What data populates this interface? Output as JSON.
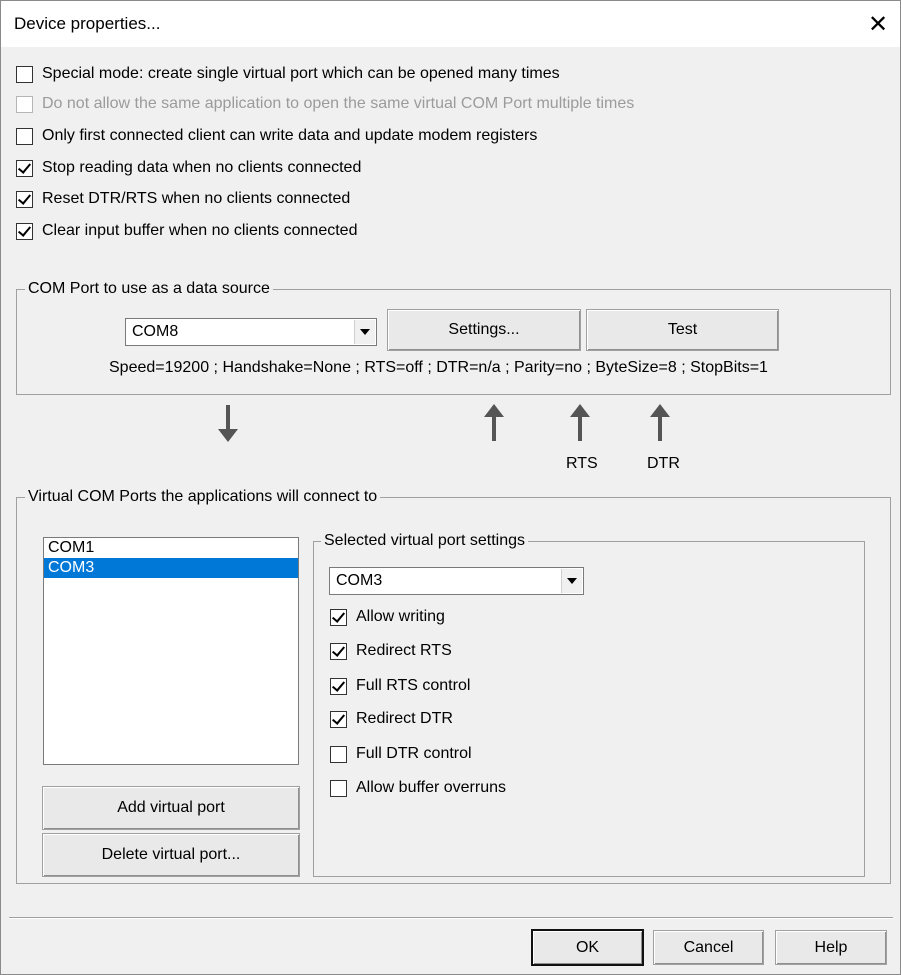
{
  "window": {
    "title": "Device properties..."
  },
  "options": [
    {
      "label": "Special mode: create single virtual port which can be opened many times",
      "checked": false,
      "disabled": false
    },
    {
      "label": "Do not allow the same application to open the same virtual COM Port multiple times",
      "checked": false,
      "disabled": true
    },
    {
      "label": "Only first connected client can write data and update modem registers",
      "checked": false,
      "disabled": false
    },
    {
      "label": "Stop reading data when no clients connected",
      "checked": true,
      "disabled": false
    },
    {
      "label": "Reset DTR/RTS when no clients connected",
      "checked": true,
      "disabled": false
    },
    {
      "label": "Clear input buffer when no clients connected",
      "checked": true,
      "disabled": false
    }
  ],
  "source_group": {
    "label": "COM Port to use as a data source",
    "selected_port": "COM8",
    "settings_button": "Settings...",
    "test_button": "Test",
    "info": "Speed=19200 ; Handshake=None ; RTS=off ; DTR=n/a ; Parity=no ; ByteSize=8 ; StopBits=1"
  },
  "signals": {
    "rts": "RTS",
    "dtr": "DTR"
  },
  "virtual_group": {
    "label": "Virtual COM Ports the applications will connect to",
    "ports": [
      "COM1",
      "COM3"
    ],
    "selected_index": 1,
    "add_button": "Add virtual port",
    "delete_button": "Delete virtual port...",
    "settings_group": {
      "label": "Selected virtual port settings",
      "selected_port": "COM3",
      "options": [
        {
          "label": "Allow writing",
          "checked": true
        },
        {
          "label": "Redirect RTS",
          "checked": true
        },
        {
          "label": "Full RTS control",
          "checked": true
        },
        {
          "label": "Redirect DTR",
          "checked": true
        },
        {
          "label": "Full DTR control",
          "checked": false
        },
        {
          "label": "Allow buffer overruns",
          "checked": false
        }
      ]
    }
  },
  "footer": {
    "ok": "OK",
    "cancel": "Cancel",
    "help": "Help"
  }
}
